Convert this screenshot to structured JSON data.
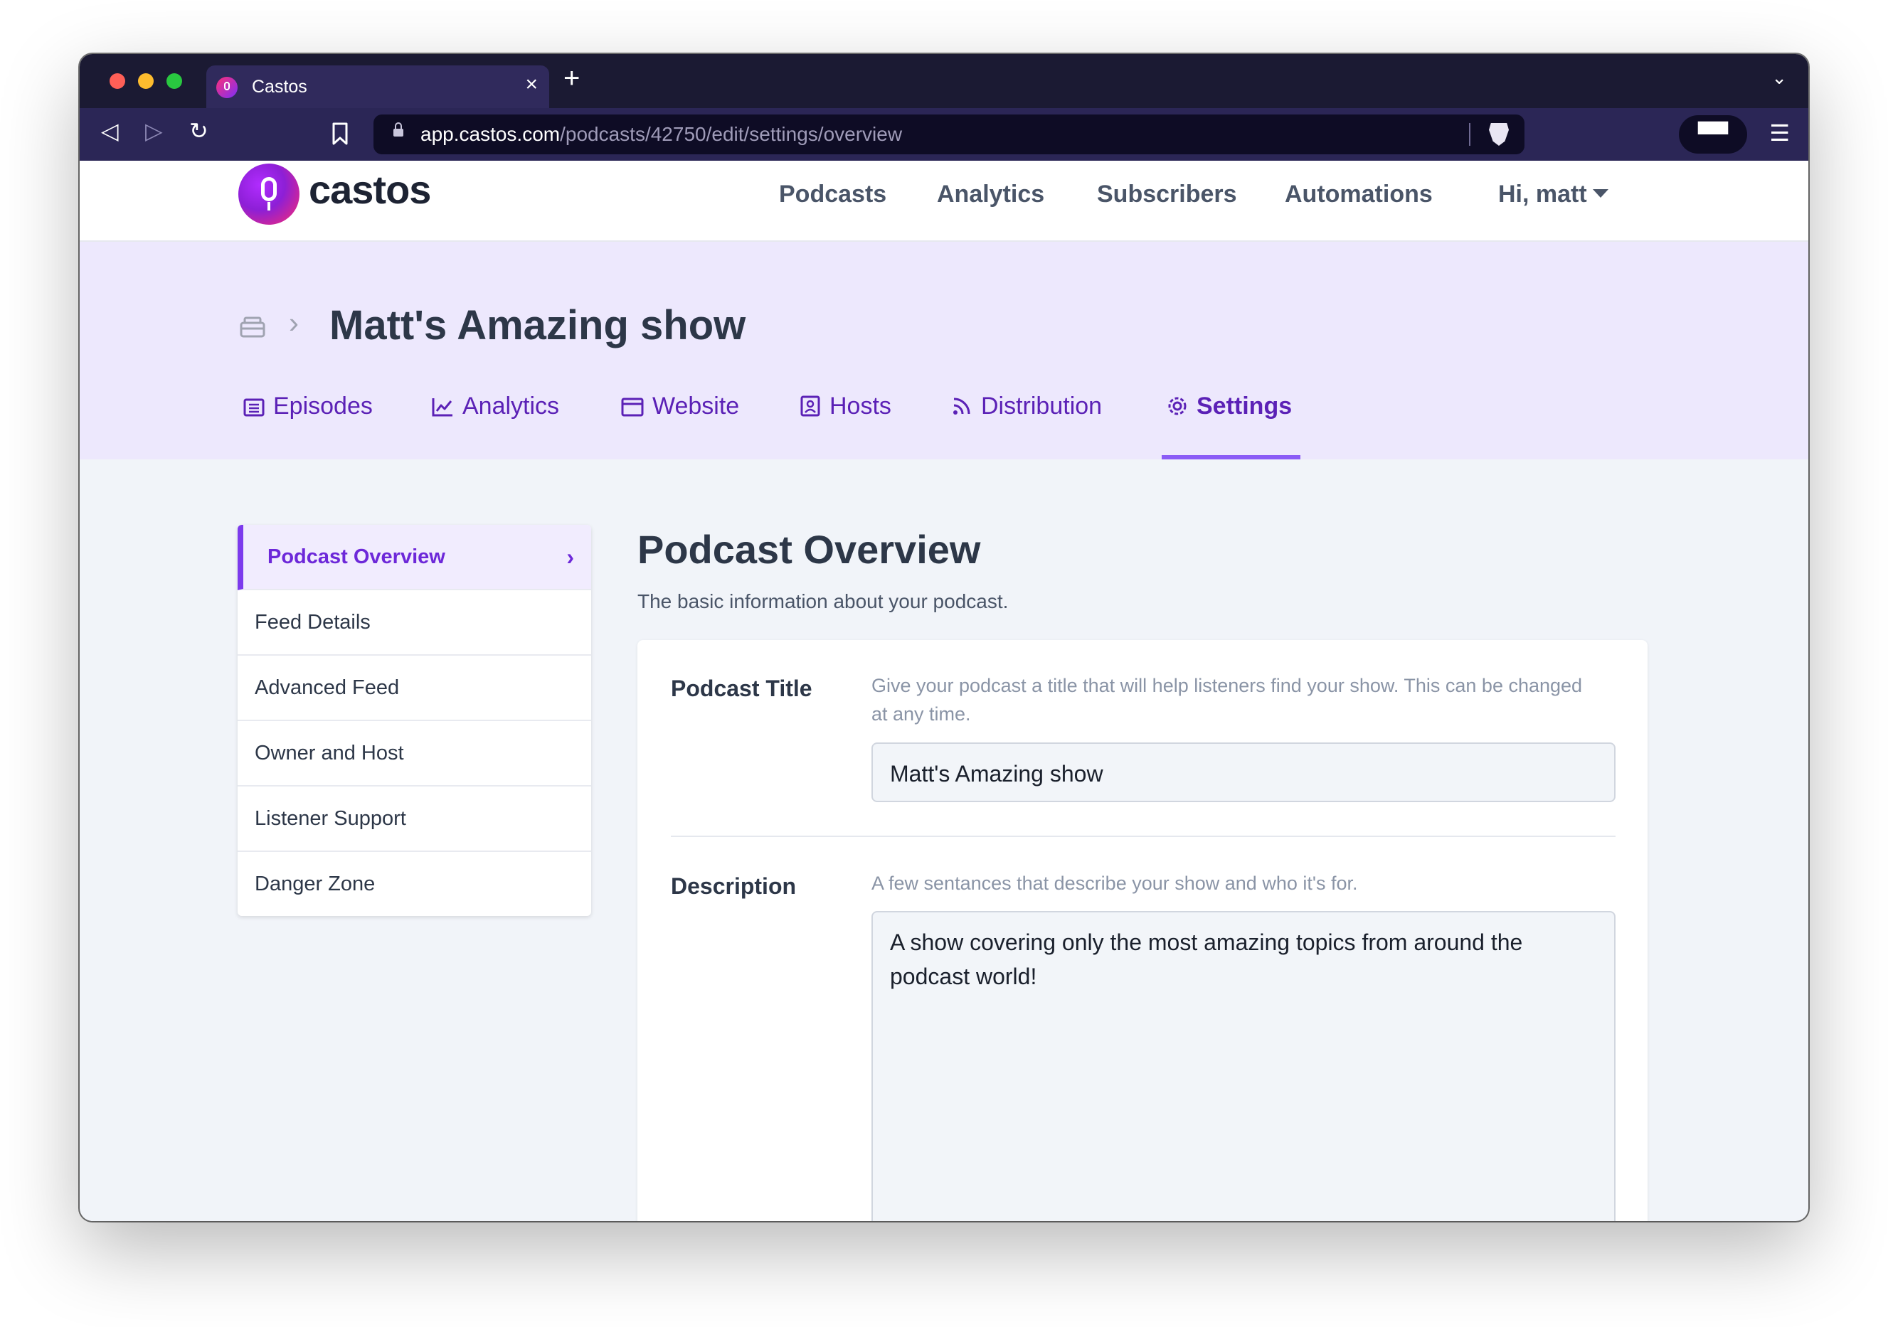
{
  "browser": {
    "tab_title": "Castos",
    "tab_close": "×",
    "new_tab": "+",
    "url_host": "app.castos.com",
    "url_path": "/podcasts/42750/edit/settings/overview",
    "back": "◁",
    "forward": "▷",
    "reload": "↻",
    "menu": "☰",
    "tab_menu": "⌄"
  },
  "app": {
    "logo_text": "castos",
    "nav": [
      "Podcasts",
      "Analytics",
      "Subscribers",
      "Automations"
    ],
    "user_menu": "Hi, matt"
  },
  "show": {
    "breadcrumb_sep": "›",
    "title": "Matt's Amazing show",
    "tabs": [
      "Episodes",
      "Analytics",
      "Website",
      "Hosts",
      "Distribution",
      "Settings"
    ],
    "active_tab": "Settings"
  },
  "sidebar": {
    "items": [
      "Podcast Overview",
      "Feed Details",
      "Advanced Feed",
      "Owner and Host",
      "Listener Support",
      "Danger Zone"
    ],
    "active_chevron": "›"
  },
  "main": {
    "title": "Podcast Overview",
    "subtitle": "The basic information about your podcast.",
    "fields": {
      "title": {
        "label": "Podcast Title",
        "help": "Give your podcast a title that will help listeners find your show. This can be changed at any time.",
        "value": "Matt's Amazing show"
      },
      "description": {
        "label": "Description",
        "help": "A few sentances that describe your show and who it's for.",
        "value": "A show covering only the most amazing topics from around the podcast world!"
      }
    }
  },
  "colors": {
    "accent": "#7c3aed",
    "show_header_bg": "#ede8fd",
    "browser_toolbar": "#2b2656"
  }
}
